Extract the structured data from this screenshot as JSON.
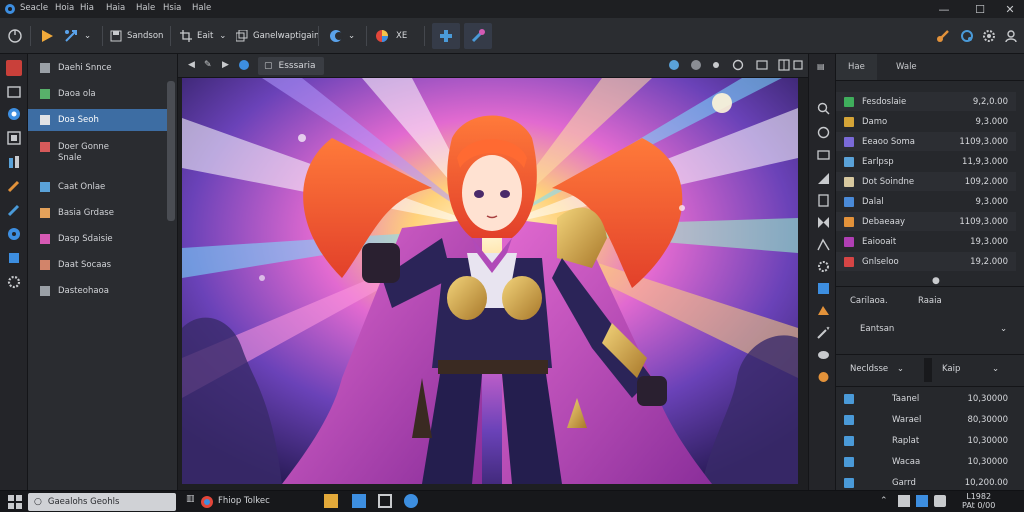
{
  "app": {
    "menu": [
      "Seacle",
      "Hoia",
      "Hia",
      "Haia",
      "Hale",
      "Hsia",
      "Hale"
    ]
  },
  "toolbar": {
    "sandbox_label": "Sandson",
    "edit_label": "Eait",
    "duplicate_label": "Ganelwaptigain",
    "fx_label": "XE",
    "dropdown_glyph": "⌄"
  },
  "left_panel": {
    "items": [
      {
        "label": "Daehi Snnce",
        "icon": "brush-icon",
        "color": "#9aa0a6"
      },
      {
        "label": "Daoa ola",
        "icon": "image-icon",
        "color": "#58b06a"
      },
      {
        "label": "Doa Seoh",
        "icon": "pen-icon",
        "color": "#e0e2e5",
        "selected": true
      },
      {
        "label": "Doer Gonne\nSnale",
        "icon": "marker-icon",
        "color": "#d65a5a"
      },
      {
        "label": "Caat Onlae",
        "icon": "layer-icon",
        "color": "#5aa2d8"
      },
      {
        "label": "Basia Grdase",
        "icon": "gradient-icon",
        "color": "#e3a15a"
      },
      {
        "label": "Dasp Sdaisie",
        "icon": "fill-icon",
        "color": "#d65ab4"
      },
      {
        "label": "Daat Socaas",
        "icon": "stamp-icon",
        "color": "#d2846a"
      },
      {
        "label": "Dasteohaoa",
        "icon": "eraser-icon",
        "color": "#9aa0a6"
      }
    ]
  },
  "canvas_tab": {
    "label": "Esssaria"
  },
  "right_panel": {
    "tabs": [
      "Hae",
      "Wale"
    ],
    "layers": [
      {
        "name": "Fesdoslaie",
        "value": "9,2,0.00",
        "color": "#3fae5c"
      },
      {
        "name": "Damo",
        "value": "9,3.000",
        "color": "#d4a437"
      },
      {
        "name": "Eeaoo Soma",
        "value": "1109,3.000",
        "color": "#7a6ad8"
      },
      {
        "name": "Earlpsp",
        "value": "11,9,3.000",
        "color": "#5aa2d8"
      },
      {
        "name": "Dot Soindne",
        "value": "109,2.000",
        "color": "#d8c9a0"
      },
      {
        "name": "Dalal",
        "value": "9,3.000",
        "color": "#4a8ad8"
      },
      {
        "name": "Debaeaay",
        "value": "1109,3.000",
        "color": "#e3923a"
      },
      {
        "name": "Eaiooait",
        "value": "19,3.000",
        "color": "#b03fb4"
      },
      {
        "name": "Gnlseloo",
        "value": "19,2.000",
        "color": "#d64545"
      }
    ],
    "props_tabs": [
      "Carilaoa.",
      "Raaia"
    ],
    "mode_label": "Eantsan",
    "blend_label": "Necldsse",
    "key_label": "Kaip",
    "list2": [
      {
        "name": "Taanel",
        "value": "10,30000",
        "color": "#4a9ad8"
      },
      {
        "name": "Warael",
        "value": "80,30000",
        "color": "#4a9ad8"
      },
      {
        "name": "Raplat",
        "value": "10,30000",
        "color": "#4a9ad8"
      },
      {
        "name": "Wacaa",
        "value": "10,30000",
        "color": "#4a9ad8"
      },
      {
        "name": "Garrd",
        "value": "10,200.00",
        "color": "#4a9ad8"
      }
    ]
  },
  "taskbar": {
    "search_label": "Gaealohs Geohls",
    "app_label": "Fhiop Tolkec",
    "clock_time": "L1982",
    "clock_date": "PAt 0/00"
  }
}
